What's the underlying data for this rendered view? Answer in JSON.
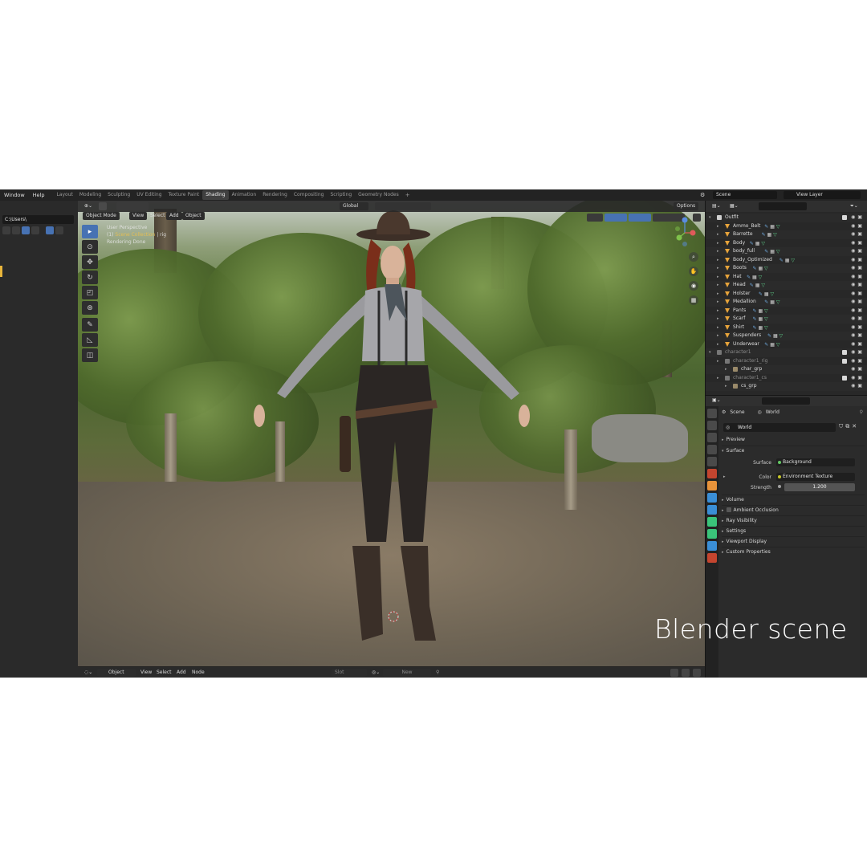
{
  "topbar": {
    "menu": [
      "Window",
      "Help"
    ],
    "workspaces": [
      "Layout",
      "Modeling",
      "Sculpting",
      "UV Editing",
      "Texture Paint",
      "Shading",
      "Animation",
      "Rendering",
      "Compositing",
      "Scripting",
      "Geometry Nodes"
    ],
    "active_workspace": "Shading",
    "add_tab": "+",
    "scene": "Scene",
    "view_layer": "View Layer"
  },
  "file_browser": {
    "path": "C:\\Users\\"
  },
  "viewport": {
    "mode": "Object Mode",
    "menus": [
      "View",
      "Select",
      "Add",
      "Object"
    ],
    "transform_orientation": "Global",
    "options": "Options",
    "overlay_text": {
      "line1": "User Perspective",
      "line2_prefix": "(1) ",
      "line2_collection": "Scene Collection",
      "line2_suffix": " | rig",
      "line3": "Rendering Done"
    },
    "tools": [
      "select",
      "cursor",
      "move",
      "rotate",
      "scale",
      "transform",
      "annotate",
      "measure",
      "add-cube"
    ]
  },
  "node_editor_bar": {
    "mode": "Object",
    "menus": [
      "View",
      "Select",
      "Add",
      "Node"
    ],
    "slot": "Slot",
    "new": "New"
  },
  "outliner": {
    "rows": [
      {
        "name": "Outfit",
        "level": 0,
        "kind": "collection"
      },
      {
        "name": "Ammo_Belt",
        "level": 1,
        "kind": "mesh"
      },
      {
        "name": "Barrette",
        "level": 1,
        "kind": "mesh"
      },
      {
        "name": "Body",
        "level": 1,
        "kind": "mesh"
      },
      {
        "name": "body_full",
        "level": 1,
        "kind": "mesh"
      },
      {
        "name": "Body_Optimized",
        "level": 1,
        "kind": "mesh"
      },
      {
        "name": "Boots",
        "level": 1,
        "kind": "mesh"
      },
      {
        "name": "Hat",
        "level": 1,
        "kind": "mesh"
      },
      {
        "name": "Head",
        "level": 1,
        "kind": "mesh"
      },
      {
        "name": "Holster",
        "level": 1,
        "kind": "mesh"
      },
      {
        "name": "Medallion",
        "level": 1,
        "kind": "mesh"
      },
      {
        "name": "Pants",
        "level": 1,
        "kind": "mesh"
      },
      {
        "name": "Scarf",
        "level": 1,
        "kind": "mesh"
      },
      {
        "name": "Shirt",
        "level": 1,
        "kind": "mesh"
      },
      {
        "name": "Suspenders",
        "level": 1,
        "kind": "mesh"
      },
      {
        "name": "Underwear",
        "level": 1,
        "kind": "mesh"
      },
      {
        "name": "character1",
        "level": 0,
        "kind": "collection-dim"
      },
      {
        "name": "character1_rig",
        "level": 1,
        "kind": "collection-dim"
      },
      {
        "name": "char_grp",
        "level": 2,
        "kind": "armature"
      },
      {
        "name": "character1_cs",
        "level": 1,
        "kind": "collection-dim"
      },
      {
        "name": "cs_grp",
        "level": 2,
        "kind": "armature"
      }
    ]
  },
  "properties": {
    "context_scene": "Scene",
    "context_world": "World",
    "world_name": "World",
    "panels": {
      "preview": "Preview",
      "surface": "Surface",
      "volume": "Volume",
      "ambient_occlusion": "Ambient Occlusion",
      "ray_visibility": "Ray Visibility",
      "settings": "Settings",
      "viewport_display": "Viewport Display",
      "custom_properties": "Custom Properties"
    },
    "surface_label": "Surface",
    "surface_value": "Background",
    "color_label": "Color",
    "color_value": "Environment Texture",
    "strength_label": "Strength",
    "strength_value": "1.200"
  },
  "caption": "Blender scene",
  "colors": {
    "accent": "#4772b3",
    "highlight": "#e8b53b",
    "mesh_icon": "#e8a43b",
    "modifier": "#6fa8dc",
    "material": "#5fd08a"
  }
}
